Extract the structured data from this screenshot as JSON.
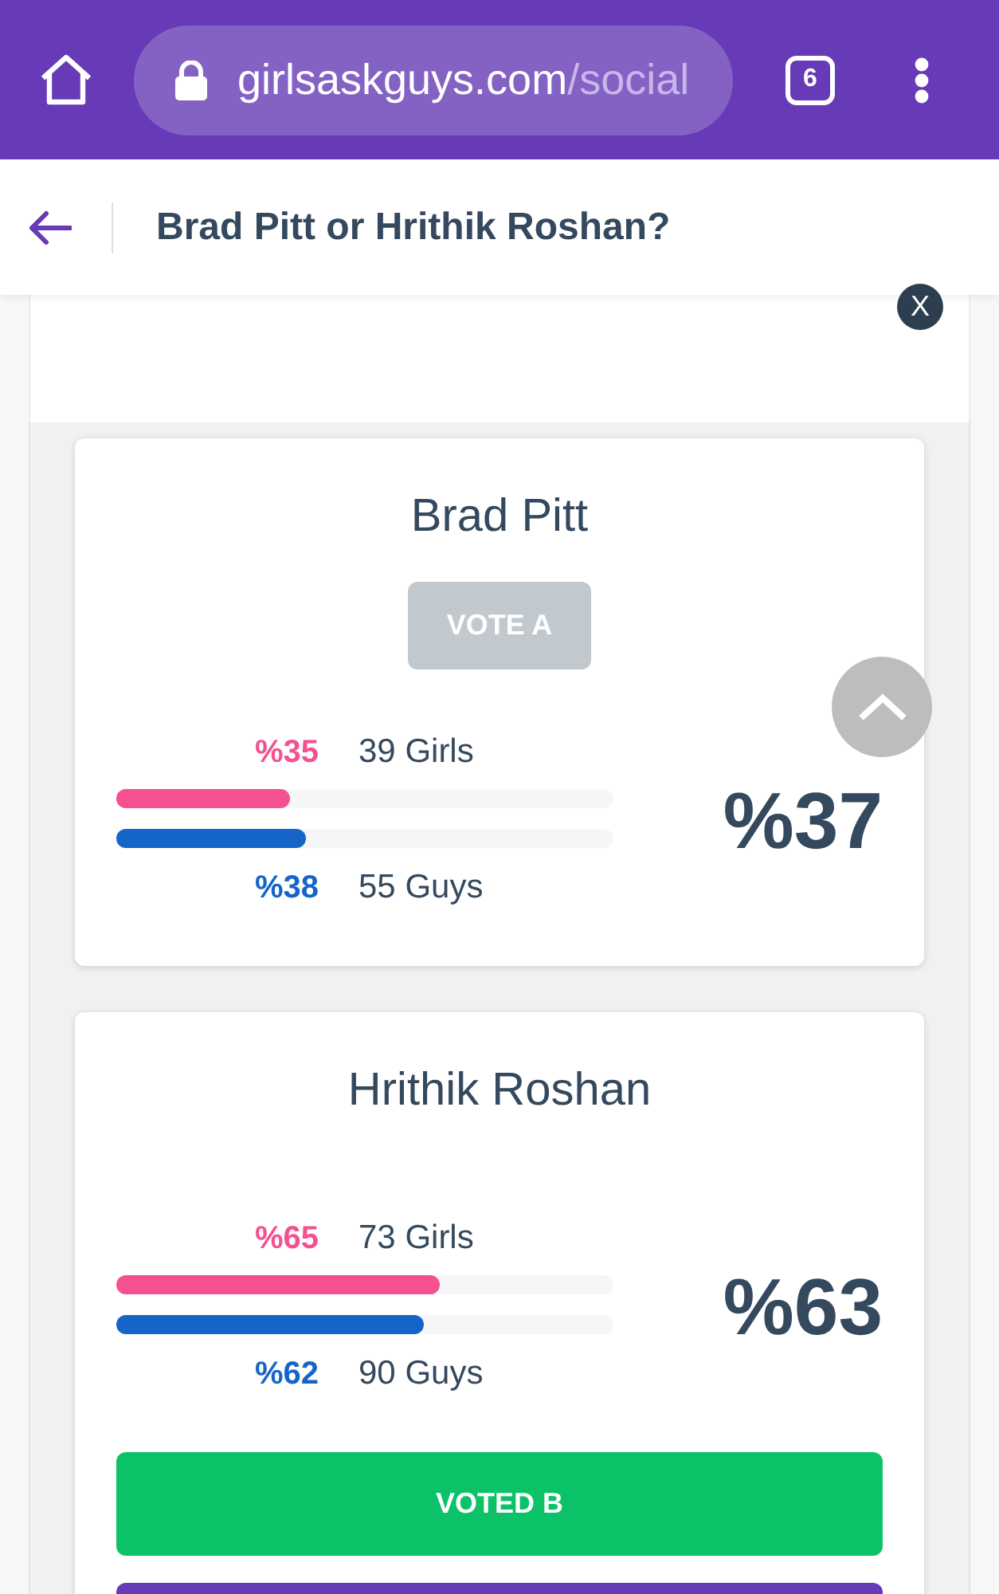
{
  "browser": {
    "url_domain": "girlsaskguys.com",
    "url_path": "/social",
    "tab_count": "6"
  },
  "header": {
    "title": "Brad Pitt or Hrithik Roshan?"
  },
  "ad": {
    "close": "X"
  },
  "options": [
    {
      "name": "Brad Pitt",
      "button": "VOTE A",
      "voted": false,
      "girls": {
        "percent": "%35",
        "count": "39 Girls",
        "level": 0.35
      },
      "guys": {
        "percent": "%38",
        "count": "55 Guys",
        "level": 0.38
      },
      "total": "%37"
    },
    {
      "name": "Hrithik Roshan",
      "button": "VOTED B",
      "voted": true,
      "girls": {
        "percent": "%65",
        "count": "73 Girls",
        "level": 0.65
      },
      "guys": {
        "percent": "%62",
        "count": "90 Guys",
        "level": 0.62
      },
      "total": "%63"
    }
  ]
}
